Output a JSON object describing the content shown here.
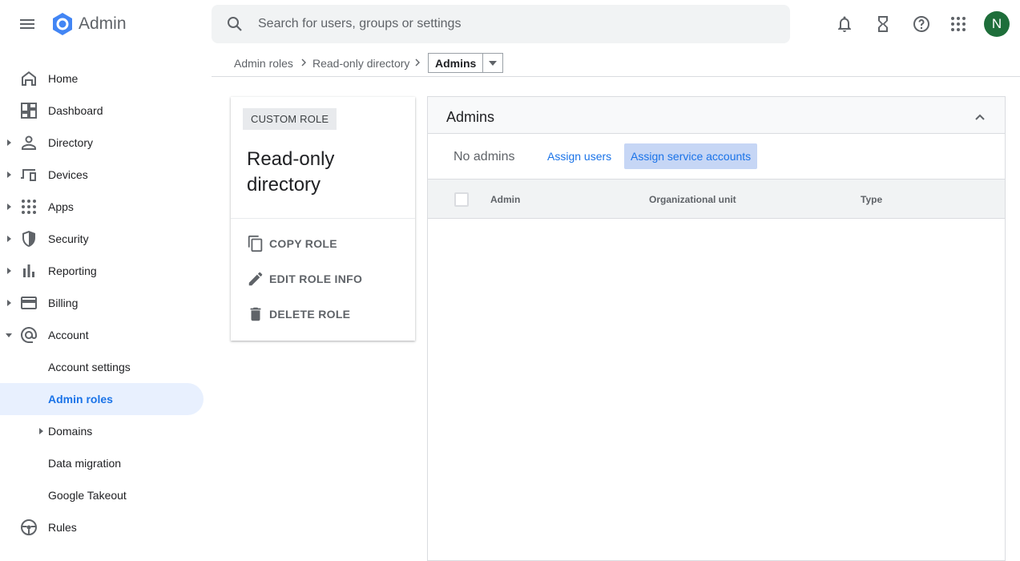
{
  "app": {
    "title": "Admin"
  },
  "search": {
    "placeholder": "Search for users, groups or settings"
  },
  "user": {
    "initial": "N"
  },
  "sidebar": {
    "items": [
      {
        "label": "Home"
      },
      {
        "label": "Dashboard"
      },
      {
        "label": "Directory"
      },
      {
        "label": "Devices"
      },
      {
        "label": "Apps"
      },
      {
        "label": "Security"
      },
      {
        "label": "Reporting"
      },
      {
        "label": "Billing"
      },
      {
        "label": "Account"
      },
      {
        "label": "Account settings"
      },
      {
        "label": "Admin roles"
      },
      {
        "label": "Domains"
      },
      {
        "label": "Data migration"
      },
      {
        "label": "Google Takeout"
      },
      {
        "label": "Rules"
      }
    ]
  },
  "breadcrumb": {
    "items": [
      "Admin roles",
      "Read-only directory"
    ],
    "current": "Admins"
  },
  "role": {
    "chip": "CUSTOM ROLE",
    "title": "Read-only directory",
    "actions": [
      "COPY ROLE",
      "EDIT ROLE INFO",
      "DELETE ROLE"
    ]
  },
  "admins": {
    "title": "Admins",
    "status": "No admins",
    "assign_users": "Assign users",
    "assign_service_accounts": "Assign service accounts",
    "columns": [
      "Admin",
      "Organizational unit",
      "Type"
    ]
  },
  "colors": {
    "accent": "#1a73e8",
    "active_bg": "#e8f0fe",
    "avatar": "#1e6e3a"
  }
}
